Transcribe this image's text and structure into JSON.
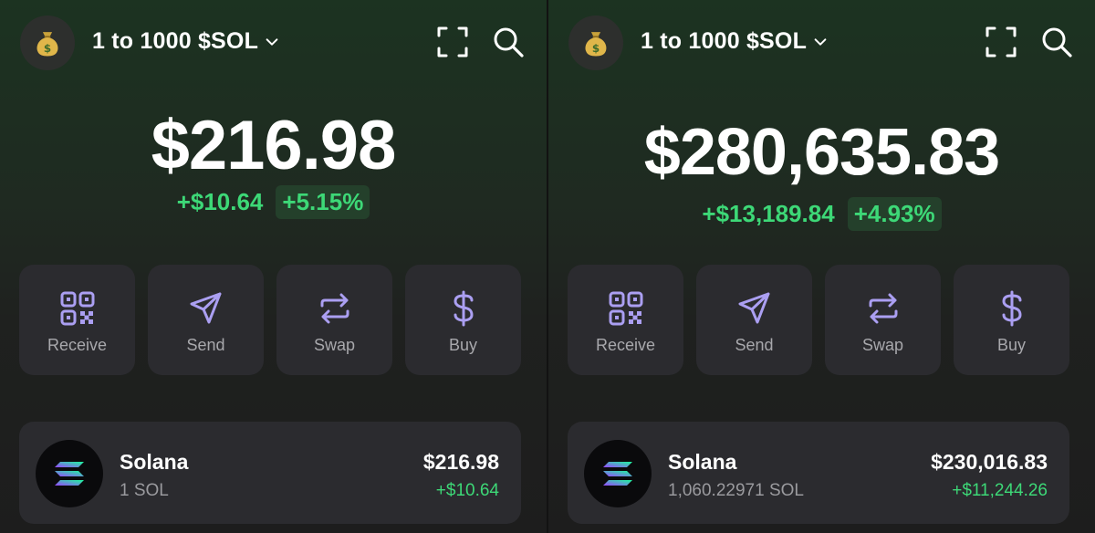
{
  "colors": {
    "accent": "#ab9ff2",
    "positive": "#3dd877",
    "card": "#2b2b2f"
  },
  "icons": {
    "avatar": "money-bag-icon",
    "chevron": "chevron-down-icon",
    "scan": "scan-qr-icon",
    "search": "search-icon",
    "receive": "qr-code-icon",
    "send": "send-plane-icon",
    "swap": "swap-arrows-icon",
    "buy": "dollar-icon",
    "token": "solana-logo-icon"
  },
  "left": {
    "account_name": "1 to 1000 $SOL",
    "balance": "$216.98",
    "change_amount": "+$10.64",
    "change_percent": "+5.15%",
    "actions": [
      "Receive",
      "Send",
      "Swap",
      "Buy"
    ],
    "token": {
      "name": "Solana",
      "amount": "1 SOL",
      "value": "$216.98",
      "change": "+$10.64"
    }
  },
  "right": {
    "account_name": "1 to 1000 $SOL",
    "balance": "$280,635.83",
    "change_amount": "+$13,189.84",
    "change_percent": "+4.93%",
    "actions": [
      "Receive",
      "Send",
      "Swap",
      "Buy"
    ],
    "token": {
      "name": "Solana",
      "amount": "1,060.22971 SOL",
      "value": "$230,016.83",
      "change": "+$11,244.26"
    }
  }
}
